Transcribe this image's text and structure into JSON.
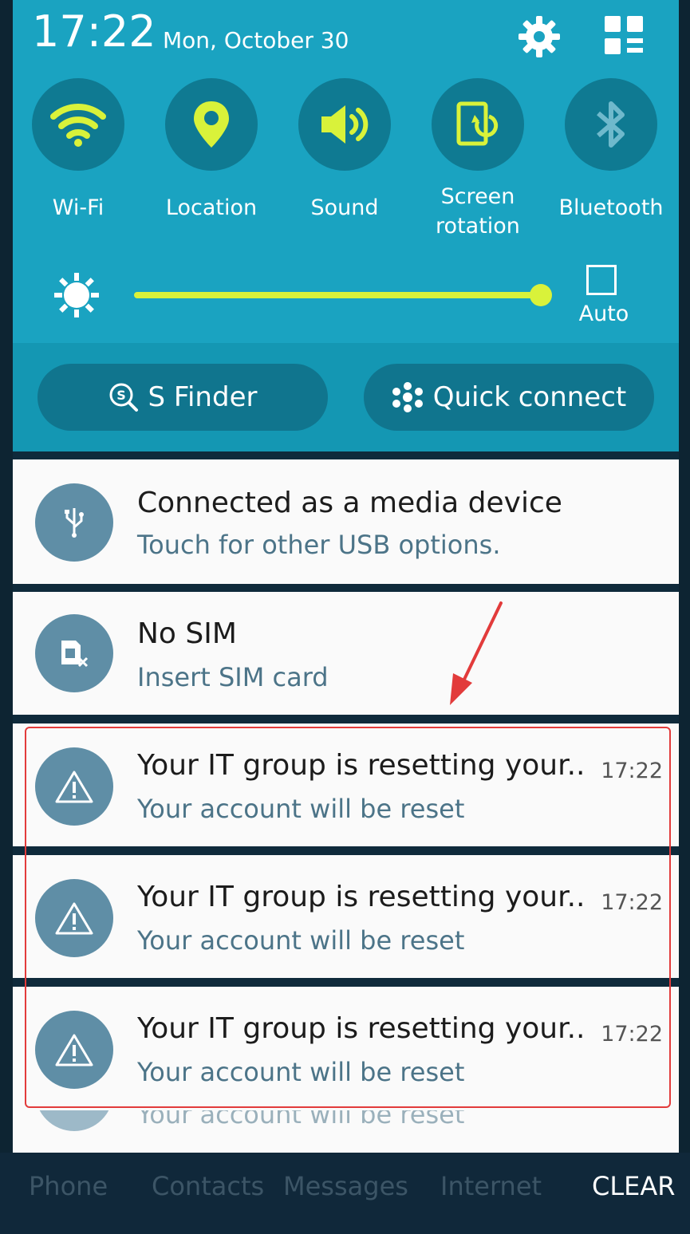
{
  "status": {
    "time": "17:22",
    "date": "Mon, October 30"
  },
  "quick_settings": {
    "toggles": [
      {
        "label": "Wi-Fi",
        "icon": "wifi-icon"
      },
      {
        "label": "Location",
        "icon": "location-pin-icon"
      },
      {
        "label": "Sound",
        "icon": "speaker-icon"
      },
      {
        "label_line1": "Screen",
        "label_line2": "rotation",
        "icon": "screen-rotation-icon"
      },
      {
        "label": "Bluetooth",
        "icon": "bluetooth-icon"
      }
    ],
    "brightness": {
      "level": 0.98,
      "auto_label": "Auto"
    },
    "s_finder": "S Finder",
    "quick_connect": "Quick connect"
  },
  "notifications": [
    {
      "title": "Connected as a media device",
      "subtitle": "Touch for other USB options.",
      "icon": "usb-icon"
    },
    {
      "title": "No SIM",
      "subtitle": "Insert SIM card",
      "icon": "no-sim-icon"
    },
    {
      "title": "Your IT group is resetting your..",
      "subtitle": "Your account will be reset",
      "time": "17:22",
      "icon": "warning-icon"
    },
    {
      "title": "Your IT group is resetting your..",
      "subtitle": "Your account will be reset",
      "time": "17:22",
      "icon": "warning-icon"
    },
    {
      "title": "Your IT group is resetting your..",
      "subtitle": "Your account will be reset",
      "time": "17:22",
      "icon": "warning-icon"
    },
    {
      "subtitle": "Your account will be reset"
    }
  ],
  "dock": [
    "Phone",
    "Contacts",
    "Messages",
    "Internet"
  ],
  "clear_label": "CLEAR",
  "colors": {
    "panel": "#1aa3c1",
    "accent": "#d9f23a",
    "annotation": "#e23b3b"
  }
}
